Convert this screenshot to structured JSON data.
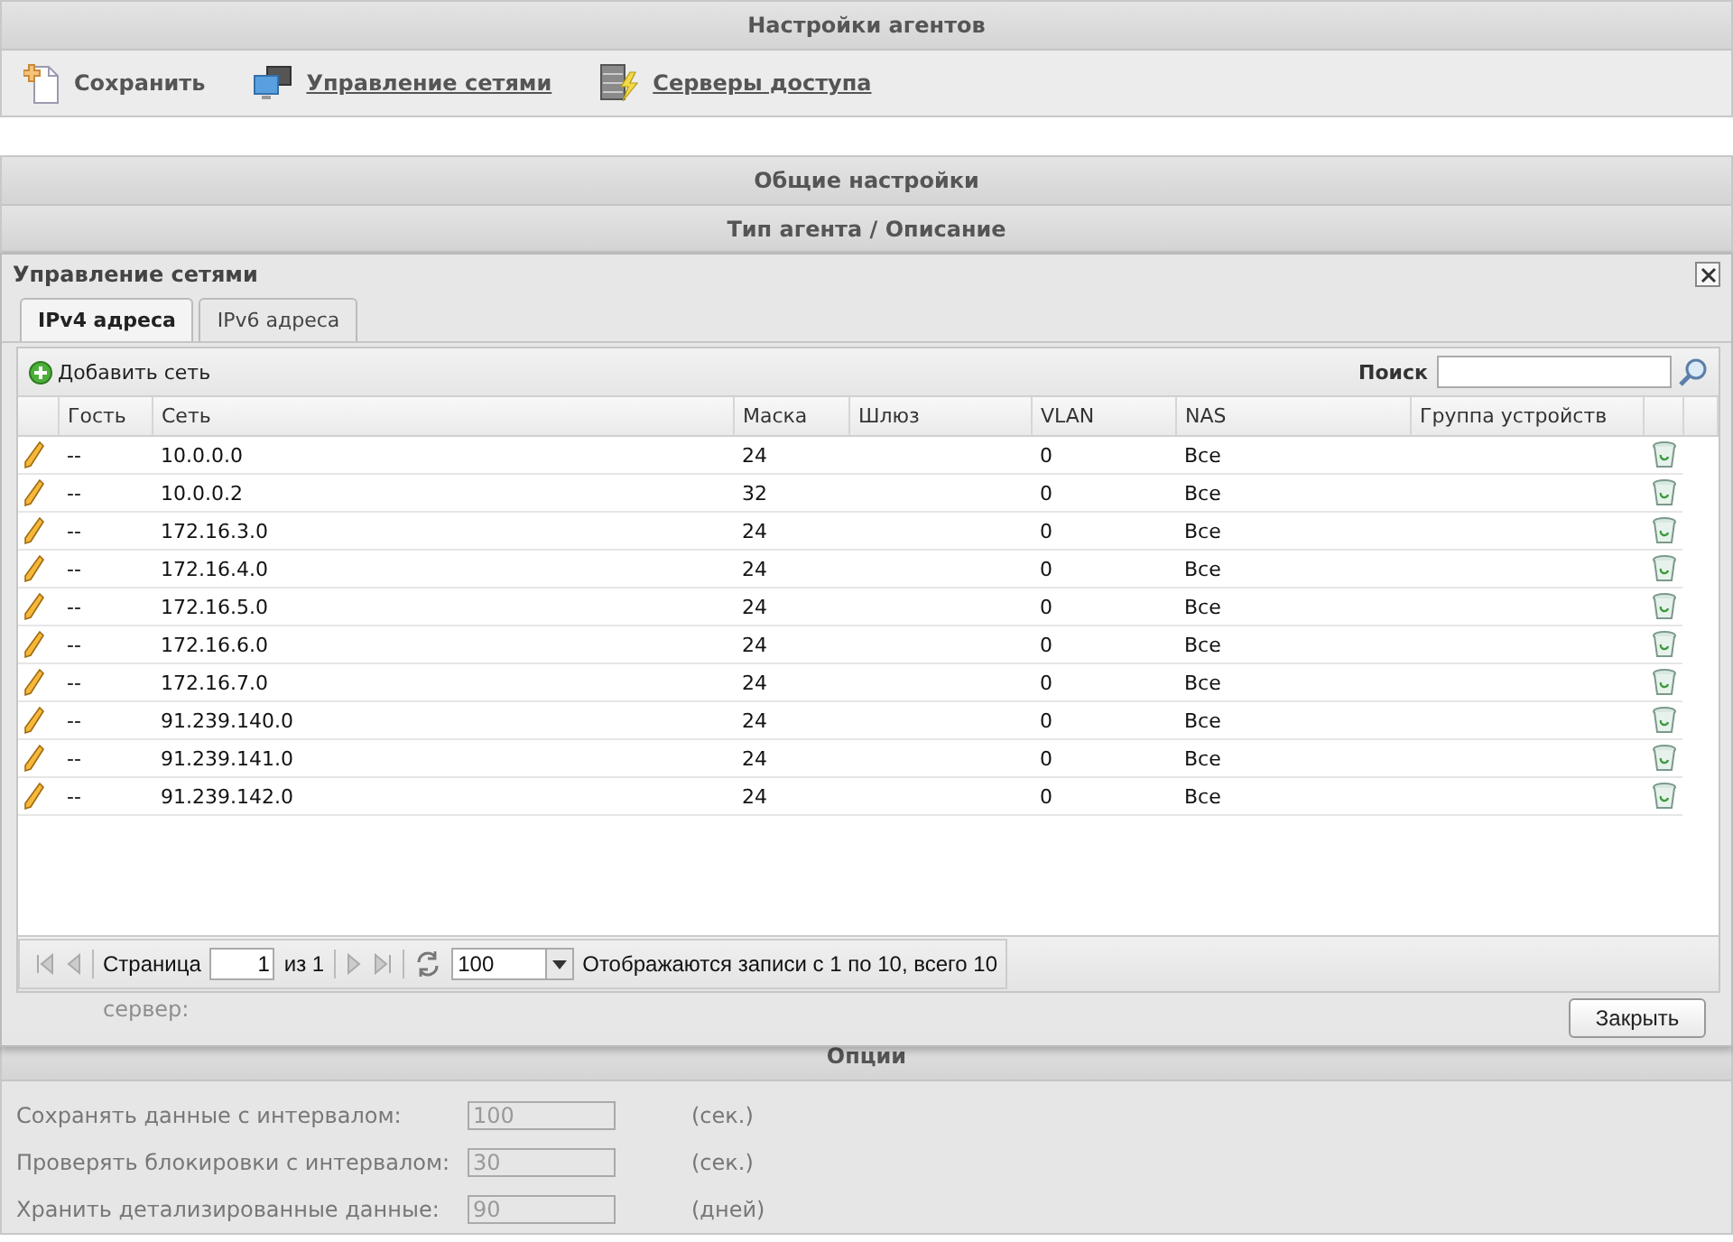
{
  "page": {
    "title": "Настройки агентов"
  },
  "toolbar": [
    {
      "kind": "save",
      "label": "Сохранить",
      "link": false
    },
    {
      "kind": "networks",
      "label": "Управление сетями",
      "link": true
    },
    {
      "kind": "servers",
      "label": "Серверы доступа",
      "link": true
    }
  ],
  "sections": {
    "general": "Общие настройки",
    "agent_type": "Тип агента / Описание",
    "hidden_label": "сервер:",
    "options_title": "Опции"
  },
  "options": [
    {
      "label": "Сохранять данные с интервалом:",
      "value": "100",
      "unit": "(сек.)",
      "disabled": true
    },
    {
      "label": "Проверять блокировки с интервалом:",
      "value": "30",
      "unit": "(сек.)",
      "disabled": true
    },
    {
      "label": "Хранить детализированные данные:",
      "value": "90",
      "unit": "(дней)",
      "disabled": true
    }
  ],
  "dialog": {
    "title": "Управление сетями",
    "tabs": [
      {
        "label": "IPv4 адреса",
        "selected": true
      },
      {
        "label": "IPv6 адреса",
        "selected": false
      }
    ],
    "add_label": "Добавить сеть",
    "search": {
      "label": "Поиск"
    },
    "columns": [
      "Гость",
      "Сеть",
      "Маска",
      "Шлюз",
      "VLAN",
      "NAS",
      "Группа устройств"
    ],
    "rows": [
      {
        "guest": "--",
        "network": "10.0.0.0",
        "mask": "24",
        "vlan": "0",
        "nas": "Все"
      },
      {
        "guest": "--",
        "network": "10.0.0.2",
        "mask": "32",
        "vlan": "0",
        "nas": "Все"
      },
      {
        "guest": "--",
        "network": "172.16.3.0",
        "mask": "24",
        "vlan": "0",
        "nas": "Все"
      },
      {
        "guest": "--",
        "network": "172.16.4.0",
        "mask": "24",
        "vlan": "0",
        "nas": "Все"
      },
      {
        "guest": "--",
        "network": "172.16.5.0",
        "mask": "24",
        "vlan": "0",
        "nas": "Все"
      },
      {
        "guest": "--",
        "network": "172.16.6.0",
        "mask": "24",
        "vlan": "0",
        "nas": "Все"
      },
      {
        "guest": "--",
        "network": "172.16.7.0",
        "mask": "24",
        "vlan": "0",
        "nas": "Все"
      },
      {
        "guest": "--",
        "network": "91.239.140.0",
        "mask": "24",
        "vlan": "0",
        "nas": "Все"
      },
      {
        "guest": "--",
        "network": "91.239.141.0",
        "mask": "24",
        "vlan": "0",
        "nas": "Все"
      },
      {
        "guest": "--",
        "network": "91.239.142.0",
        "mask": "24",
        "vlan": "0",
        "nas": "Все"
      }
    ],
    "pager": {
      "page_label": "Страница",
      "page": "1",
      "of_label": "из 1",
      "page_size": "100",
      "summary": "Отображаются записи с 1 по 10, всего 10"
    },
    "close_button": "Закрыть"
  }
}
